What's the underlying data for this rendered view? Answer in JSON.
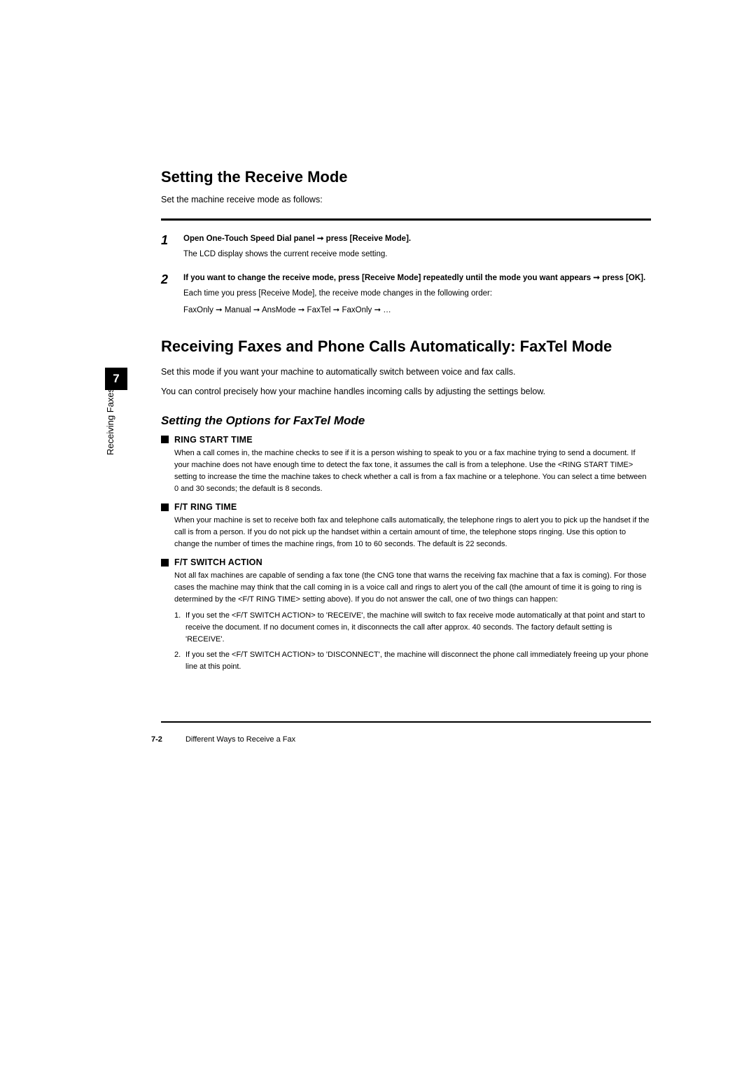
{
  "sidebar": {
    "chapter_number": "7",
    "chapter_label": "Receiving Faxes"
  },
  "section1": {
    "heading": "Setting the Receive Mode",
    "intro": "Set the machine receive mode as follows:",
    "steps": [
      {
        "num": "1",
        "bold": "Open One-Touch Speed Dial panel ➞ press [Receive Mode].",
        "lines": [
          "The LCD display shows the current receive mode setting."
        ]
      },
      {
        "num": "2",
        "bold": "If you want to change the receive mode, press [Receive Mode] repeatedly until the mode you want appears ➞ press [OK].",
        "lines": [
          "Each time you press [Receive Mode], the receive mode changes in the following order:",
          "FaxOnly ➞ Manual ➞ AnsMode ➞ FaxTel ➞ FaxOnly ➞ …"
        ]
      }
    ]
  },
  "section2": {
    "heading": "Receiving Faxes and Phone Calls Automatically: FaxTel Mode",
    "paras": [
      "Set this mode if you want your machine to automatically switch between voice and fax calls.",
      "You can control precisely how your machine handles incoming calls by adjusting the settings below."
    ],
    "subheading": "Setting the Options for FaxTel Mode",
    "options": [
      {
        "title": "RING START TIME",
        "body": "When a call comes in, the machine checks to see if it is a person wishing to speak to you or a fax machine trying to send a document. If your machine does not have enough time to detect the fax tone, it assumes the call is from a telephone. Use the <RING START TIME> setting to increase the time the machine takes to check whether a call is from a fax machine or a telephone. You can select a time between 0 and 30 seconds; the default is 8 seconds."
      },
      {
        "title": "F/T RING TIME",
        "body": "When your machine is set to receive both fax and telephone calls automatically, the telephone rings to alert you to pick up the handset if the call is from a person. If you do not pick up the handset within a certain amount of time, the telephone stops ringing. Use this option to change the number of times the machine rings, from 10 to 60 seconds. The default is 22 seconds."
      },
      {
        "title": "F/T SWITCH ACTION",
        "body": "Not all fax machines are capable of sending a fax tone (the CNG tone that warns the receiving fax machine that a fax is coming). For those cases the machine may think that the call coming in is a voice call and rings to alert you of the call (the amount of time it is going to ring is determined by the <F/T RING TIME> setting above). If you do not answer the call, one of two things can happen:",
        "numbered": [
          "If you set the <F/T SWITCH ACTION> to 'RECEIVE', the machine will switch to fax receive mode automatically at that point and start to receive the document. If no document comes in, it disconnects the call after approx. 40 seconds. The factory default setting is 'RECEIVE'.",
          "If you set the <F/T SWITCH ACTION> to 'DISCONNECT', the machine will disconnect the phone call immediately freeing up your phone line at this point."
        ]
      }
    ]
  },
  "footer": {
    "page": "7-2",
    "title": "Different Ways to Receive a Fax"
  }
}
